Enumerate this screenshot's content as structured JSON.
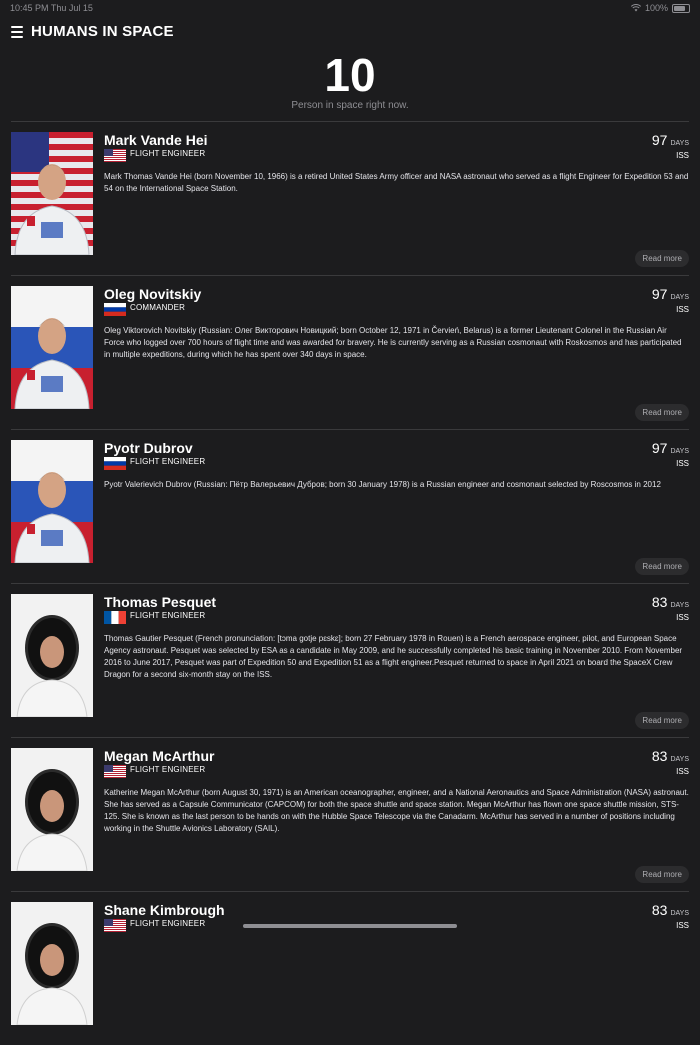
{
  "status_bar": {
    "time": "10:45 PM",
    "date": "Thu Jul 15",
    "battery": "100%"
  },
  "header": {
    "title": "HUMANS IN SPACE"
  },
  "summary": {
    "count": "10",
    "subtitle": "Person in space right now."
  },
  "colors": {
    "background": "#1c1c1e",
    "divider": "#3a3a3c",
    "muted": "#8e8e93"
  },
  "people": [
    {
      "name": "Mark Vande Hei",
      "role": "FLIGHT ENGINEER",
      "flag": "us",
      "photo_bg": "american-flag",
      "suit": "orange",
      "days": "97",
      "days_unit": "DAYS",
      "station": "ISS",
      "bio": "Mark Thomas Vande Hei (born November 10, 1966) is a retired United States Army officer and NASA astronaut who served as a flight Engineer for Expedition 53 and 54 on the International Space Station.",
      "read_more": "Read more"
    },
    {
      "name": "Oleg Novitskiy",
      "role": "COMMANDER",
      "flag": "ru",
      "photo_bg": "russian-flag",
      "suit": "orange",
      "days": "97",
      "days_unit": "DAYS",
      "station": "ISS",
      "bio": "Oleg Viktorovich Novitskiy (Russian: Олег Викторович Новицкий; born October 12, 1971 in Červień, Belarus) is a former Lieutenant Colonel in the Russian Air Force who logged over 700 hours of flight time and was awarded for bravery. He is currently serving as a Russian cosmonaut with Roskosmos and has participated in multiple expeditions, during which he has spent over 340 days in space.",
      "read_more": "Read more"
    },
    {
      "name": "Pyotr Dubrov",
      "role": "FLIGHT ENGINEER",
      "flag": "ru",
      "photo_bg": "russian-flag",
      "suit": "orange",
      "days": "97",
      "days_unit": "DAYS",
      "station": "ISS",
      "bio": "Pyotr Valerievich Dubrov (Russian: Пётр Валерьевич Дубров; born 30 January 1978) is a Russian engineer and cosmonaut selected by Roscosmos in 2012",
      "read_more": "Read more"
    },
    {
      "name": "Thomas Pesquet",
      "role": "FLIGHT ENGINEER",
      "flag": "fr",
      "photo_bg": "plain",
      "suit": "white",
      "days": "83",
      "days_unit": "DAYS",
      "station": "ISS",
      "bio": "Thomas Gautier Pesquet (French pronunciation: [tɔma gotje pɛskɛ]; born 27 February 1978 in Rouen) is a French aerospace engineer, pilot, and European Space Agency astronaut. Pesquet was selected by ESA as a candidate in May 2009, and he successfully completed his basic training in November 2010. From November 2016 to June 2017, Pesquet was part of Expedition 50 and Expedition 51 as a flight engineer.Pesquet returned to space in April 2021 on board the SpaceX Crew Dragon for a second six-month stay on the ISS.",
      "read_more": "Read more"
    },
    {
      "name": "Megan McArthur",
      "role": "FLIGHT ENGINEER",
      "flag": "us",
      "photo_bg": "plain",
      "suit": "white",
      "days": "83",
      "days_unit": "DAYS",
      "station": "ISS",
      "bio": "Katherine Megan McArthur (born August 30, 1971) is an American oceanographer, engineer, and a National Aeronautics and Space Administration (NASA) astronaut. She has served as a Capsule Communicator (CAPCOM) for both the space shuttle and space station. Megan McArthur has flown one space shuttle mission, STS-125. She is known as the last person to be hands on with the Hubble Space Telescope via the Canadarm. McArthur has served in a number of positions including working in the Shuttle Avionics Laboratory (SAIL).",
      "read_more": "Read more"
    },
    {
      "name": "Shane Kimbrough",
      "role": "FLIGHT ENGINEER",
      "flag": "us",
      "photo_bg": "plain",
      "suit": "white",
      "days": "83",
      "days_unit": "DAYS",
      "station": "ISS",
      "bio": "",
      "read_more": ""
    }
  ]
}
